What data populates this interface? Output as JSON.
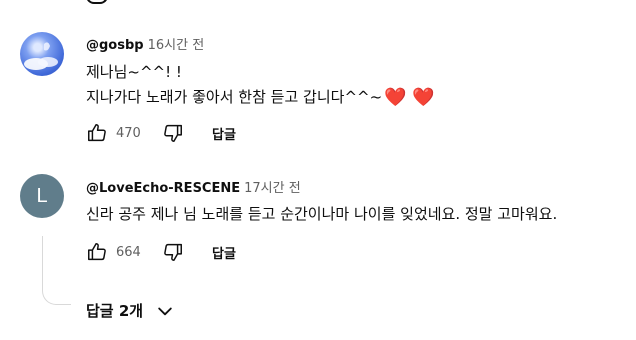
{
  "comments": [
    {
      "author": "@gosbp",
      "time": "16시간 전",
      "lines": [
        "제나님~^^! !",
        "지나가다 노래가 좋아서 한참 듣고 갑니다^^~"
      ],
      "hearts": "❤️ ❤️",
      "likes": "470",
      "reply_label": "답글",
      "avatar_icon": "sky-cloud-avatar"
    },
    {
      "author": "@LoveEcho-RESCENE",
      "time": "17시간 전",
      "lines": [
        "신라 공주 제나 님 노래를 듣고 순간이나마 나이를 잊었네요. 정말 고마워요."
      ],
      "likes": "664",
      "reply_label": "답글",
      "avatar_letter": "L",
      "avatar_color": "#607d8b"
    }
  ],
  "replies_toggle": {
    "label": "답글 2개",
    "icon": "chevron-down-icon"
  },
  "colors": {
    "text": "#0f0f0f",
    "secondary": "#606060",
    "heart": "#dd2e44"
  }
}
